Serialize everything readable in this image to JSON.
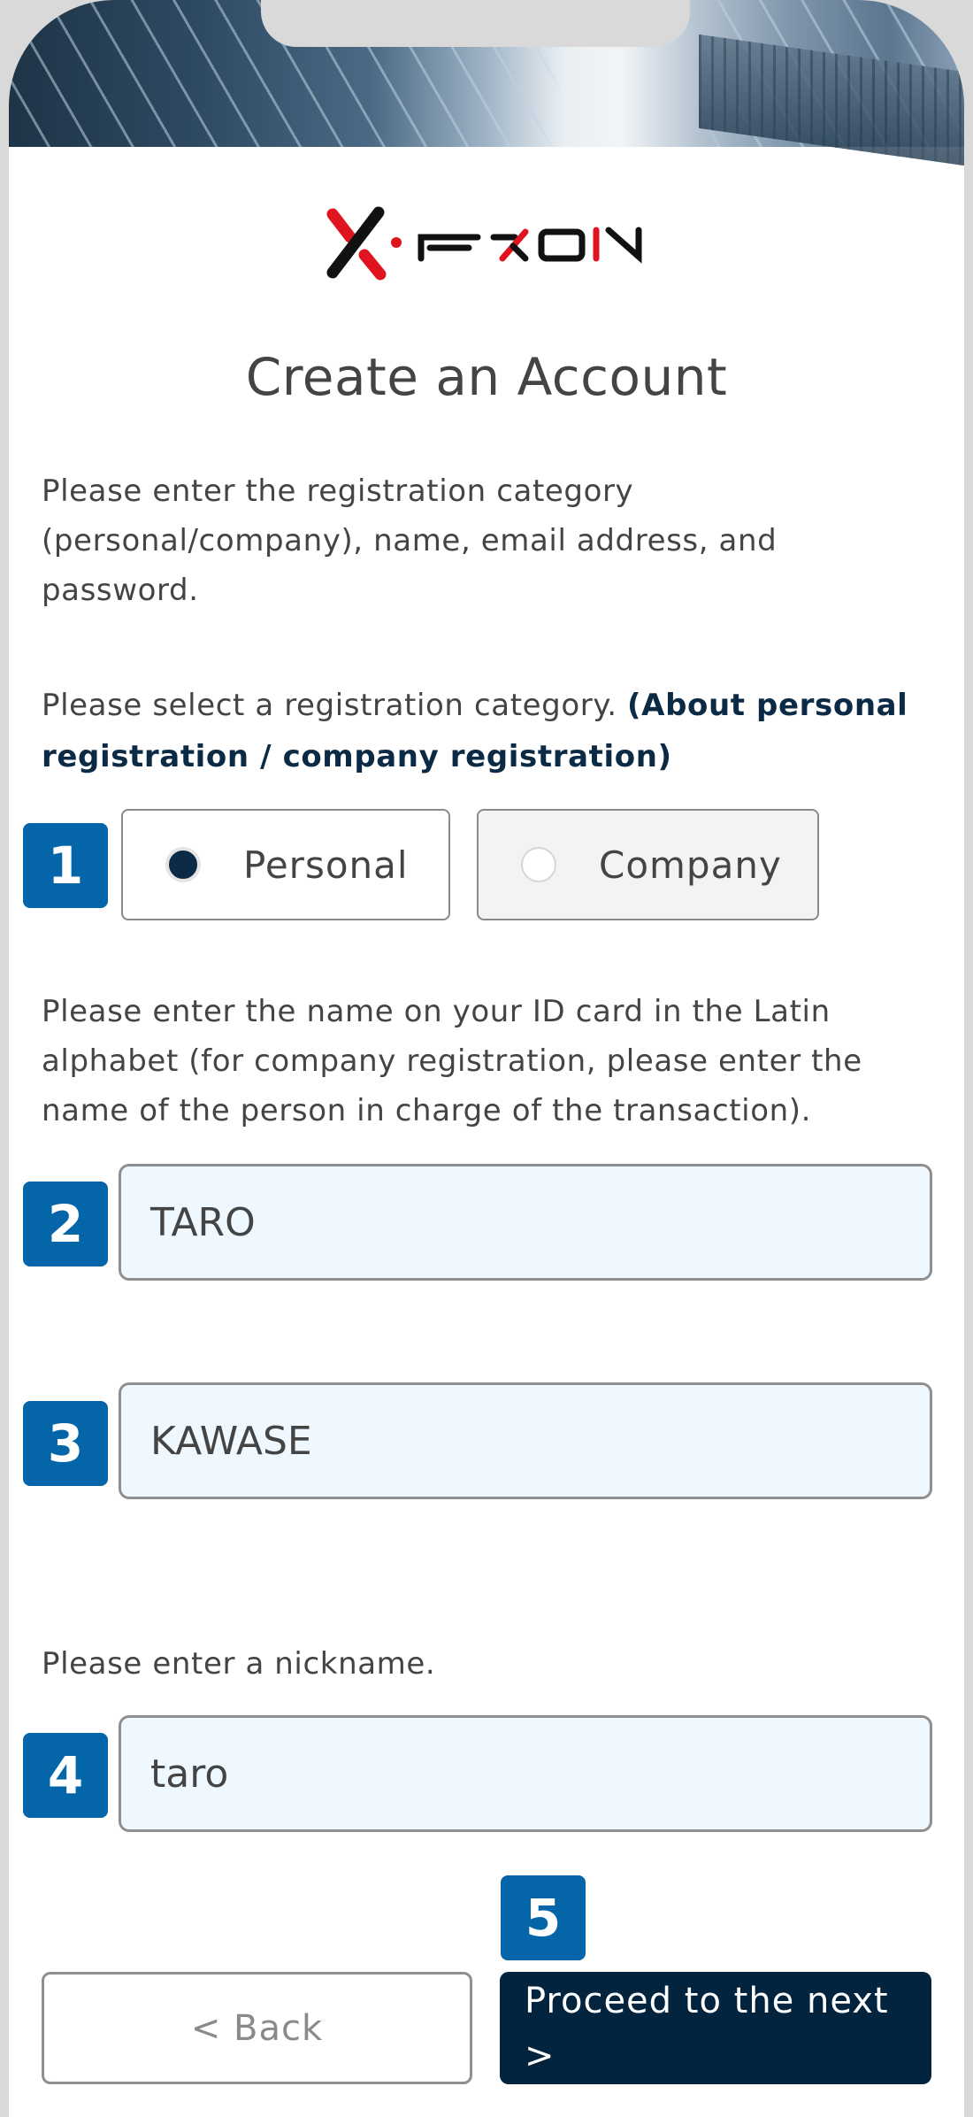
{
  "header": {
    "image_description": "skyscrapers-looking-up"
  },
  "logo": {
    "text": "FXON",
    "icon": "fxon-logo-mark",
    "colors": {
      "red": "#e0141e",
      "black": "#111111"
    }
  },
  "page": {
    "title": "Create an Account",
    "intro": "Please enter the registration category (personal/company), name, email address, and password."
  },
  "category": {
    "prompt": "Please select a registration category. ",
    "link": "(About personal registration / company registration)",
    "badge": "1",
    "options": [
      {
        "label": "Personal",
        "selected": true
      },
      {
        "label": "Company",
        "selected": false
      }
    ]
  },
  "name": {
    "instruction": "Please enter the name on your ID card in the Latin alphabet (for company registration, please enter the name of the person in charge of the transaction).",
    "first_name": {
      "badge": "2",
      "value": "TARO"
    },
    "last_name": {
      "badge": "3",
      "value": "KAWASE"
    }
  },
  "nickname": {
    "instruction": "Please enter a nickname.",
    "badge": "4",
    "value": "taro"
  },
  "actions": {
    "badge": "5",
    "back_label": "< Back",
    "next_label": "Proceed to the next >"
  },
  "colors": {
    "badge": "#0565a9",
    "primary_button": "#02243f",
    "input_bg": "#eef8fe",
    "link_text": "#0b2a45"
  }
}
